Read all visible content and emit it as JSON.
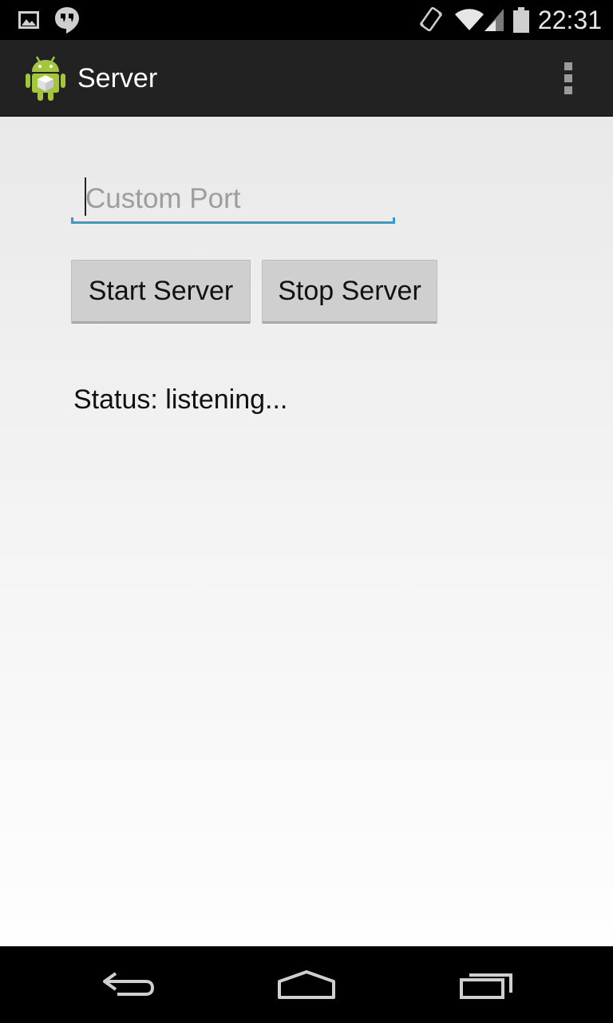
{
  "status_bar": {
    "time": "22:31",
    "icons": [
      "gallery-notification-icon",
      "hangouts-notification-icon",
      "vibrate-icon",
      "wifi-icon",
      "signal-icon",
      "battery-icon"
    ]
  },
  "action_bar": {
    "title": "Server",
    "app_icon": "android-app-icon",
    "overflow_icon": "overflow-menu-icon"
  },
  "form": {
    "port_placeholder": "Custom Port",
    "port_value": "",
    "start_label": "Start Server",
    "stop_label": "Stop Server",
    "status_text": "Status: listening..."
  },
  "navigation": {
    "back": "back-icon",
    "home": "home-icon",
    "recents": "recents-icon"
  },
  "colors": {
    "accent": "#2a9fd6",
    "action_bar": "#222222",
    "button": "#cfcfcf"
  }
}
